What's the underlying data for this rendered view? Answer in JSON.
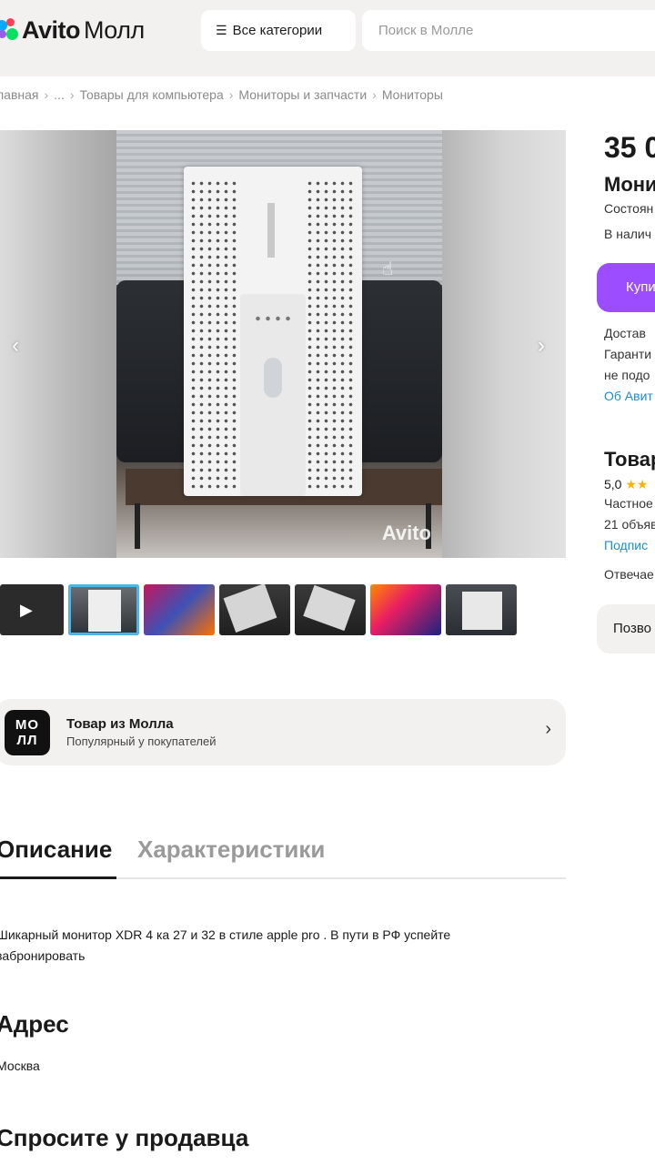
{
  "header": {
    "logo_brand": "Avito",
    "logo_suffix": "Молл",
    "categories_label": "Все категории",
    "search_placeholder": "Поиск в Молле"
  },
  "breadcrumb": [
    "лавная",
    "...",
    "Товары для компьютера",
    "Мониторы и запчасти",
    "Мониторы"
  ],
  "gallery": {
    "watermark": "Avito"
  },
  "mall_banner": {
    "badge_top": "МО",
    "badge_bottom": "ЛЛ",
    "title": "Товар из Молла",
    "subtitle": "Популярный у покупателей"
  },
  "tabs": {
    "description": "Описание",
    "specs": "Характеристики"
  },
  "description_text": "Шикарный монитор XDR 4 ка 27 и 32 в стиле apple pro . В пути в РФ успейте забронировать",
  "address": {
    "heading": "Адрес",
    "value": "Москва"
  },
  "ask_heading": "Спросите у продавца",
  "right_panel": {
    "price": "35 0",
    "title": "Мони",
    "condition": "Состоян",
    "availability": "В налич",
    "buy_label": "Купи",
    "delivery": "Достав",
    "guarantee": "Гаранти",
    "not_fit": "не подо",
    "about_link": "Об Авит",
    "seller_title": "Товар",
    "rating_value": "5,0",
    "rating_stars": "★★",
    "seller_type": "Частное",
    "ads_count": "21 объяв",
    "subscribe": "Подпис",
    "responds": "Отвечае",
    "call_label": "Позво"
  },
  "colors": {
    "accent_purple": "#9b4dff",
    "link_blue": "#1a8cd8",
    "thumb_active": "#4db6e8"
  }
}
